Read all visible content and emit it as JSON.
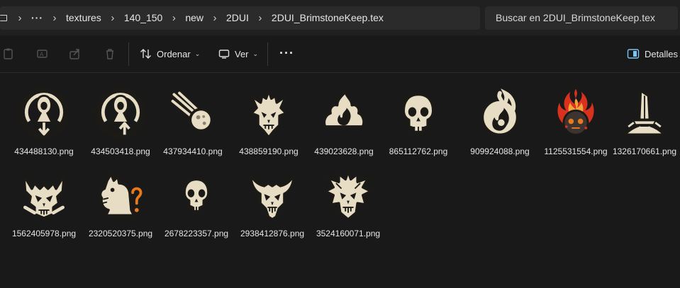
{
  "breadcrumb": {
    "overflow": "···",
    "items": [
      "textures",
      "140_150",
      "new",
      "2DUI",
      "2DUI_BrimstoneKeep.tex"
    ]
  },
  "search": {
    "placeholder": "Buscar en 2DUI_BrimstoneKeep.tex"
  },
  "toolbar": {
    "sort_label": "Ordenar",
    "view_label": "Ver",
    "more_label": "···",
    "details_label": "Detalles"
  },
  "colors": {
    "icon_fill": "#e7dcc4",
    "icon_outline": "#1c1a17",
    "accent_orange": "#e77a1c",
    "fire_red": "#d8321e"
  },
  "files": [
    {
      "name": "434488130.png",
      "icon": "hooded-figure-down-arrow-icon"
    },
    {
      "name": "434503418.png",
      "icon": "hooded-figure-up-arrow-icon"
    },
    {
      "name": "437934410.png",
      "icon": "comet-icon"
    },
    {
      "name": "438859190.png",
      "icon": "horned-demon-skull-icon"
    },
    {
      "name": "439023628.png",
      "icon": "flame-sun-icon"
    },
    {
      "name": "865112762.png",
      "icon": "skull-icon"
    },
    {
      "name": "909924088.png",
      "icon": "fire-swirl-icon"
    },
    {
      "name": "1125531554.png",
      "icon": "burning-skull-icon"
    },
    {
      "name": "1326170661.png",
      "icon": "sword-in-stone-icon"
    },
    {
      "name": "1562405978.png",
      "icon": "demon-skull-icon"
    },
    {
      "name": "2320520375.png",
      "icon": "hound-question-icon"
    },
    {
      "name": "2678223357.png",
      "icon": "small-skull-icon"
    },
    {
      "name": "2938412876.png",
      "icon": "winged-demon-icon"
    },
    {
      "name": "3524160071.png",
      "icon": "spiked-demon-icon"
    }
  ]
}
